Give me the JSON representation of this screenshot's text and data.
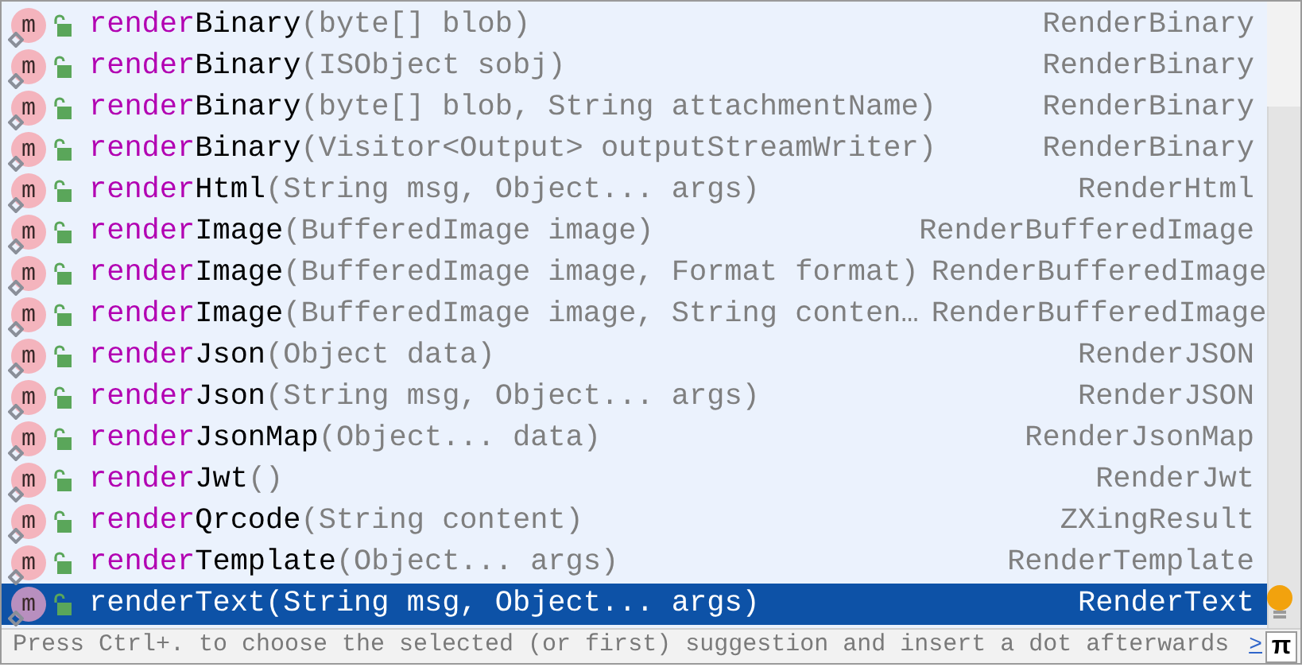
{
  "completion": {
    "items": [
      {
        "icon_letter": "m",
        "match": "render",
        "rest": "Binary",
        "params": "(byte[] blob)",
        "type": "RenderBinary",
        "selected": false
      },
      {
        "icon_letter": "m",
        "match": "render",
        "rest": "Binary",
        "params": "(ISObject sobj)",
        "type": "RenderBinary",
        "selected": false
      },
      {
        "icon_letter": "m",
        "match": "render",
        "rest": "Binary",
        "params": "(byte[] blob, String attachmentName)",
        "type": "RenderBinary",
        "selected": false
      },
      {
        "icon_letter": "m",
        "match": "render",
        "rest": "Binary",
        "params": "(Visitor<Output> outputStreamWriter)",
        "type": "RenderBinary",
        "selected": false
      },
      {
        "icon_letter": "m",
        "match": "render",
        "rest": "Html",
        "params": "(String msg, Object... args)",
        "type": "RenderHtml",
        "selected": false
      },
      {
        "icon_letter": "m",
        "match": "render",
        "rest": "Image",
        "params": "(BufferedImage image)",
        "type": "RenderBufferedImage",
        "selected": false
      },
      {
        "icon_letter": "m",
        "match": "render",
        "rest": "Image",
        "params": "(BufferedImage image, Format format)",
        "type": "RenderBufferedImage",
        "selected": false
      },
      {
        "icon_letter": "m",
        "match": "render",
        "rest": "Image",
        "params": "(BufferedImage image, String conten…",
        "type": "RenderBufferedImage",
        "selected": false
      },
      {
        "icon_letter": "m",
        "match": "render",
        "rest": "Json",
        "params": "(Object data)",
        "type": "RenderJSON",
        "selected": false
      },
      {
        "icon_letter": "m",
        "match": "render",
        "rest": "Json",
        "params": "(String msg, Object... args)",
        "type": "RenderJSON",
        "selected": false
      },
      {
        "icon_letter": "m",
        "match": "render",
        "rest": "JsonMap",
        "params": "(Object... data)",
        "type": "RenderJsonMap",
        "selected": false
      },
      {
        "icon_letter": "m",
        "match": "render",
        "rest": "Jwt",
        "params": "()",
        "type": "RenderJwt",
        "selected": false
      },
      {
        "icon_letter": "m",
        "match": "render",
        "rest": "Qrcode",
        "params": "(String content)",
        "type": "ZXingResult",
        "selected": false
      },
      {
        "icon_letter": "m",
        "match": "render",
        "rest": "Template",
        "params": "(Object... args)",
        "type": "RenderTemplate",
        "selected": false
      },
      {
        "icon_letter": "m",
        "match": "render",
        "rest": "Text",
        "params": "(String msg, Object... args)",
        "type": "RenderText",
        "selected": true
      }
    ]
  },
  "status_bar": {
    "hint": "Press Ctrl+. to choose the selected (or first) suggestion and insert a dot afterwards",
    "link": ">",
    "pi_button": "π"
  }
}
